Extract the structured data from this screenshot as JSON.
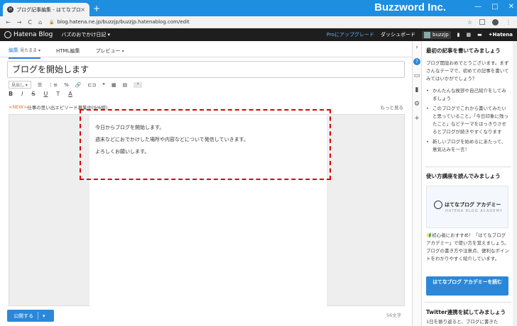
{
  "browser": {
    "tab_title": "ブログ記事編集 - はてなブログ",
    "tab_close": "×",
    "new_tab": "+",
    "brand": "Buzzword Inc.",
    "win_min": "—",
    "win_max": "□",
    "win_close": "✕",
    "back": "←",
    "forward": "→",
    "reload": "C",
    "home": "⌂",
    "lock": "🔒",
    "url": "blog.hatena.ne.jp/buzzjp/buzzjp.hatenablog.com/edit",
    "star": "☆",
    "menu": "⋮"
  },
  "hatena_bar": {
    "logo": "Hatena Blog",
    "blog_name": "バズのおでかけ日記 ▾",
    "pro": "Proにアップグレード",
    "dashboard": "ダッシュボード",
    "user": "buzzjp",
    "hatena": "✦Hatena"
  },
  "editor": {
    "tabs": [
      {
        "label": "編集",
        "sub": "見たまま ▾"
      },
      {
        "label": "HTML編集",
        "sub": ""
      },
      {
        "label": "プレビュー",
        "sub": "▾"
      }
    ],
    "title": "ブログを開始します",
    "heading_select": "見出し ▾",
    "toolbar1": [
      "☰",
      "⋮≡",
      "%",
      "🔗",
      "⊏⊐",
      "❝",
      "▦",
      "▤",
      "⌃"
    ],
    "toolbar2": [
      "B",
      "I",
      "S",
      "U",
      "T",
      "A"
    ],
    "tag_new": "<NEW>",
    "tag_text": "仕事の思い出エピソード募集中(9/6締)",
    "tag_more": "もっと見る",
    "body_lines": [
      "今日からブログを開始します。",
      "週末などにおでかけした場所や内容などについて発信していきます。",
      "よろしくお願いします。"
    ],
    "publish": "公開する",
    "publish_caret": "▾",
    "char_count": "56文字"
  },
  "sidebar": {
    "section1_title": "最初の記事を書いてみましょう",
    "section1_intro": "ブログ開設おめでとうございます。まずさんなテーマで、初めての記事を書いてみてはいかがでしょう？",
    "bullets": [
      "かんたんな挨拶や自己紹介をしてみましょう",
      "このブログでこれから書いてみたいと思っていること。「今日印象に残ったこと」などテーマをはっきりさせるとブログが続きやすくなります",
      "新しいブログを始めるにあたって、意気込みを一言！"
    ],
    "section2_title": "使い方講座を読んでみましょう",
    "academy_title": "はてなブログ アカデミー",
    "academy_sub": "HATENA BLOG ACADEMY",
    "section2_text": "🔰初心者におすすめ！「はてなブログ アカデミー」で使い方を覚えましょう。ブログの書き方や注意点、便利なポイントをわかりやすく紹介しています。",
    "cta": "はてなブログ アカデミーを読む",
    "section3_title": "Twitter連携を試してみましょう",
    "section3_text": "1日を振り返ると、ブログに書きた"
  },
  "rail_icons": [
    "›",
    "?",
    "▭",
    "▮",
    "⚙",
    "+"
  ]
}
